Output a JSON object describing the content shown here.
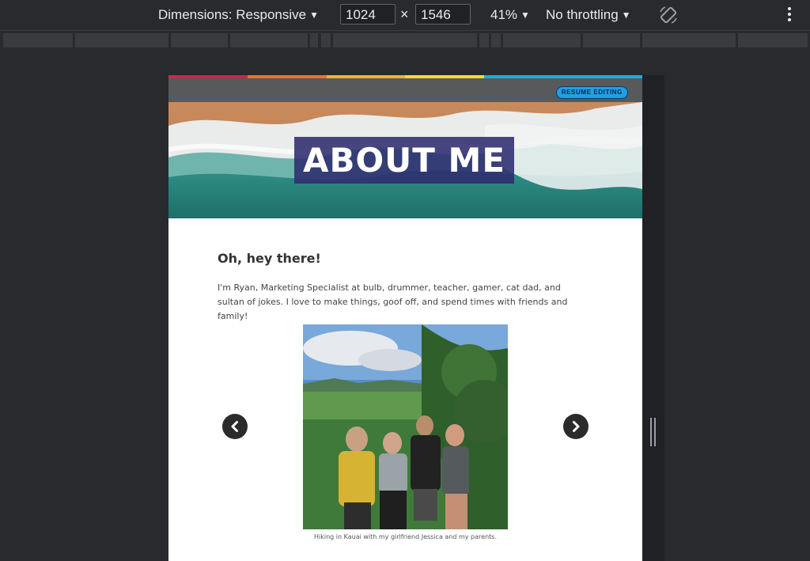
{
  "devtools": {
    "dimensions_label": "Dimensions: Responsive",
    "width_value": "1024",
    "height_value": "1546",
    "times_symbol": "×",
    "zoom": "41%",
    "throttling": "No throttling"
  },
  "site": {
    "stripe_colors": [
      "#d6204e",
      "#e8742c",
      "#f2b134",
      "#f3dd2a",
      "#1fa9e0",
      "#1fa9e0"
    ],
    "resume_button": "RESUME EDITING",
    "hero_title": "ABOUT ME",
    "greeting": "Oh, hey there!",
    "intro": "I'm Ryan, Marketing Specialist at bulb, drummer, teacher, gamer, cat dad, and sultan of jokes. I love to make things, goof off, and spend times with friends and family!",
    "caption": "Hiking in Kauai with my girlfriend Jessica and my parents."
  },
  "icons": {
    "prev": "chevron-left-icon",
    "next": "chevron-right-icon",
    "rotate": "rotate-icon",
    "more": "kebab-menu-icon"
  }
}
